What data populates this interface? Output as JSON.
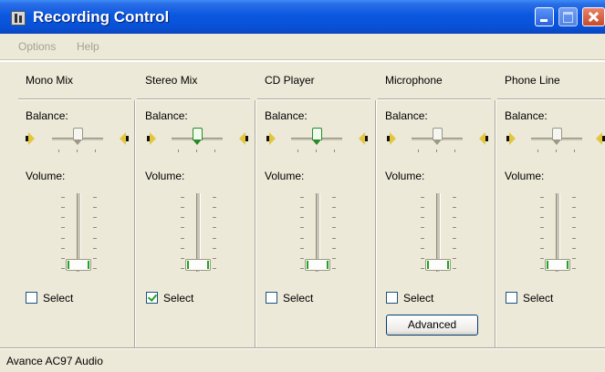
{
  "window": {
    "title": "Recording Control"
  },
  "menu": [
    "Options",
    "Help"
  ],
  "labels": {
    "balance": "Balance:",
    "volume": "Volume:",
    "select": "Select"
  },
  "columns": [
    {
      "name": "Mono Mix",
      "selected": false,
      "balance": 0.5,
      "volume": 0.0
    },
    {
      "name": "Stereo Mix",
      "selected": true,
      "balance": 0.5,
      "volume": 0.0
    },
    {
      "name": "CD Player",
      "selected": false,
      "balance": 0.5,
      "volume": 0.0
    },
    {
      "name": "Microphone",
      "selected": false,
      "balance": 0.5,
      "volume": 0.0
    },
    {
      "name": "Phone Line",
      "selected": false,
      "balance": 0.5,
      "volume": 0.0
    }
  ],
  "advanced_button": "Advanced",
  "status": "Avance AC97 Audio",
  "colors": {
    "title_bar": "#0a58e0",
    "face": "#ece9d8",
    "check_green": "#21a121"
  }
}
